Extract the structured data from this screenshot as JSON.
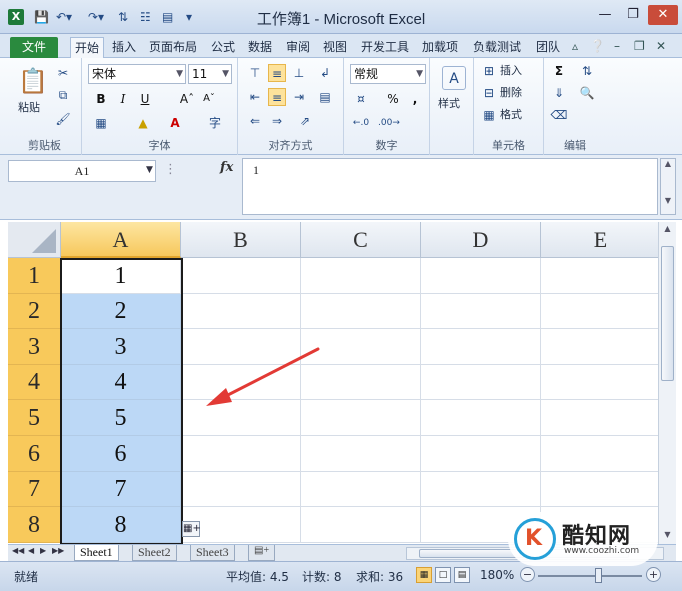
{
  "window": {
    "title": "工作簿1 - Microsoft Excel",
    "app_icon": "X"
  },
  "tabs": [
    {
      "label": "文件"
    },
    {
      "label": "开始"
    },
    {
      "label": "插入"
    },
    {
      "label": "页面布局"
    },
    {
      "label": "公式"
    },
    {
      "label": "数据"
    },
    {
      "label": "审阅"
    },
    {
      "label": "视图"
    },
    {
      "label": "开发工具"
    },
    {
      "label": "加载项"
    },
    {
      "label": "负载测试"
    },
    {
      "label": "团队"
    }
  ],
  "active_tab": "开始",
  "ribbon": {
    "clipboard": {
      "paste": "粘贴",
      "label": "剪贴板"
    },
    "font": {
      "name": "宋体",
      "size": "11",
      "bold": "B",
      "italic": "I",
      "underline": "U",
      "label": "字体"
    },
    "alignment": {
      "label": "对齐方式"
    },
    "number": {
      "format": "常规",
      "percent": "%",
      "comma": ",",
      "label": "数字"
    },
    "styles": {
      "label": "样式"
    },
    "cells": {
      "insert": "插入",
      "delete": "删除",
      "format": "格式",
      "label": "单元格"
    },
    "editing": {
      "label": "编辑"
    }
  },
  "formula_bar": {
    "name_box": "A1",
    "fx": "fx",
    "value": "1"
  },
  "grid": {
    "columns": [
      "A",
      "B",
      "C",
      "D",
      "E"
    ],
    "rows": [
      "1",
      "2",
      "3",
      "4",
      "5",
      "6",
      "7",
      "8"
    ],
    "column_a_values": [
      "1",
      "2",
      "3",
      "4",
      "5",
      "6",
      "7",
      "8"
    ]
  },
  "sheets": [
    {
      "label": "Sheet1"
    },
    {
      "label": "Sheet2"
    },
    {
      "label": "Sheet3"
    }
  ],
  "status": {
    "mode": "就绪",
    "average": "平均值: 4.5",
    "count": "计数: 8",
    "sum": "求和: 36",
    "zoom": "180%"
  },
  "watermark": {
    "name": "酷知网",
    "url": "www.coozhi.com",
    "logo_letter": "K"
  },
  "colors": {
    "selection_fill": "#bcd8f6",
    "header_highlight": "#f8c95b",
    "arrow": "#e23a35",
    "file_tab": "#2a8a3e"
  }
}
